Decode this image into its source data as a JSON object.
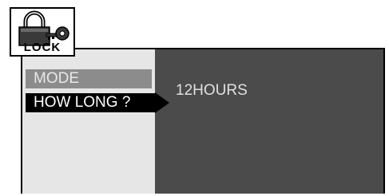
{
  "badge": {
    "label": "LOCK",
    "icon": "padlock-with-key-icon"
  },
  "menu": {
    "items": [
      {
        "label": "MODE",
        "selected": false
      },
      {
        "label": "HOW LONG ?",
        "selected": true
      }
    ]
  },
  "value_panel": {
    "value": "12HOURS"
  },
  "colors": {
    "menu_background": "#e6e6e6",
    "value_background": "#4b4b4b",
    "selected_background": "#000000",
    "unselected_background": "#8c8c8c"
  }
}
